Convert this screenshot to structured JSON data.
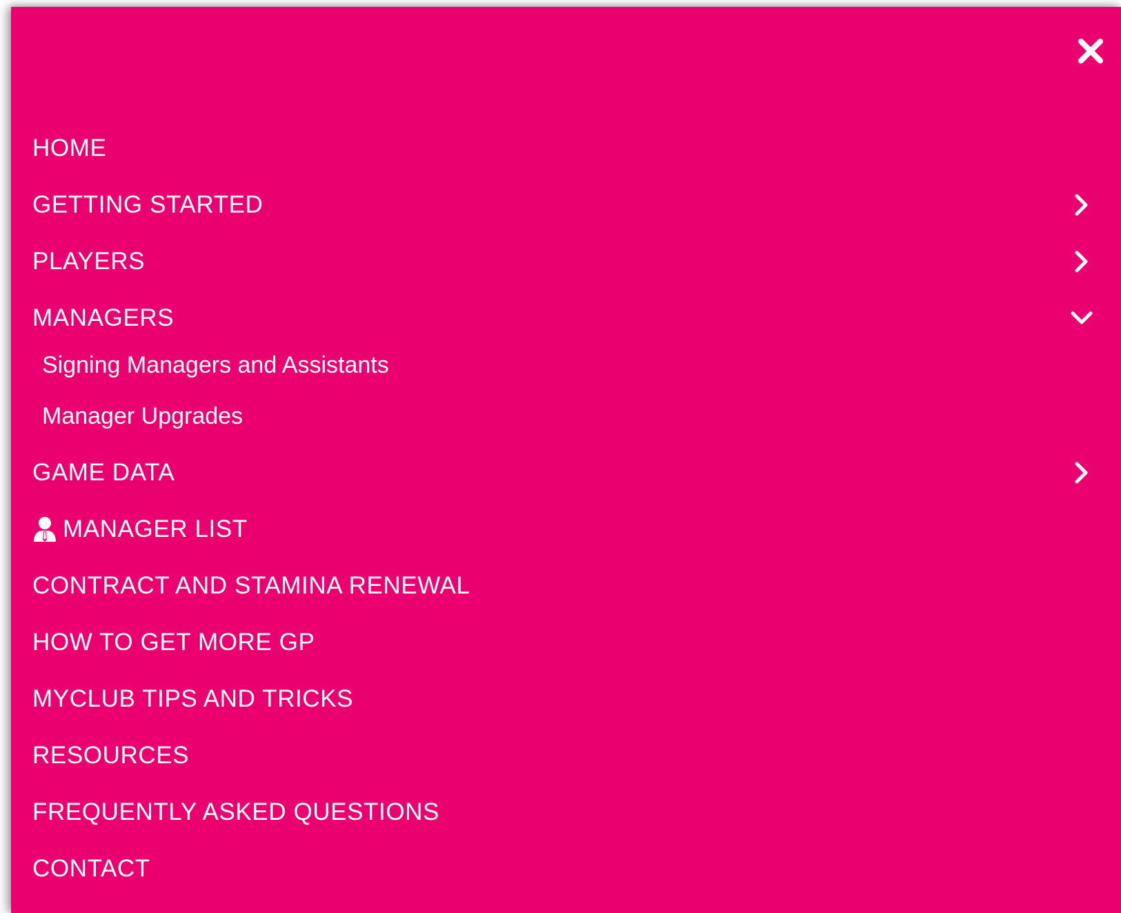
{
  "colors": {
    "panel_background": "#EB006F",
    "text": "#FFFFFF"
  },
  "close_icon": "close-icon",
  "menu": {
    "items": [
      {
        "label": "HOME",
        "icon": null
      },
      {
        "label": "GETTING STARTED",
        "icon": "chevron-right-icon"
      },
      {
        "label": "PLAYERS",
        "icon": "chevron-right-icon"
      },
      {
        "label": "MANAGERS",
        "icon": "chevron-down-icon",
        "expanded": true,
        "subitems": [
          {
            "label": "Signing Managers and Assistants"
          },
          {
            "label": "Manager Upgrades"
          }
        ]
      },
      {
        "label": "GAME DATA",
        "icon": "chevron-right-icon"
      },
      {
        "label": "MANAGER LIST",
        "leading_icon": "manager-person-icon"
      },
      {
        "label": "CONTRACT AND STAMINA RENEWAL"
      },
      {
        "label": "HOW TO GET MORE GP"
      },
      {
        "label": "MYCLUB TIPS AND TRICKS"
      },
      {
        "label": "RESOURCES"
      },
      {
        "label": "FREQUENTLY ASKED QUESTIONS"
      },
      {
        "label": "CONTACT"
      }
    ]
  }
}
